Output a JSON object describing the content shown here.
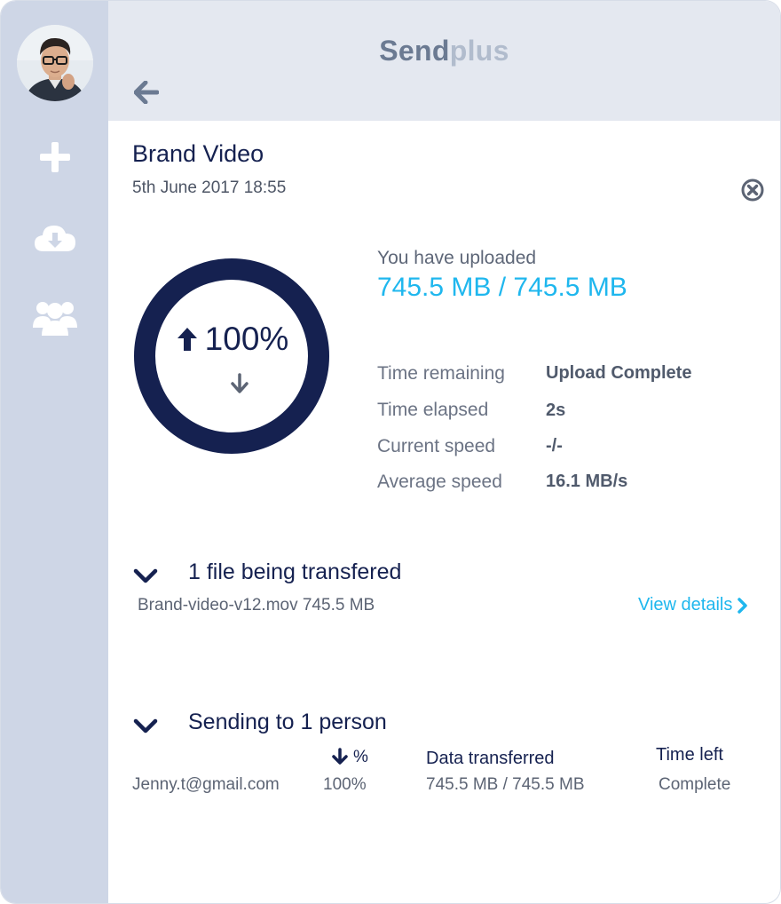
{
  "app": {
    "brand_part1": "Send",
    "brand_part2": "plus",
    "brand_color_primary": "#6b7a92",
    "brand_color_secondary": "#b1bccd",
    "accent_color": "#1fb7ee",
    "navy_color": "#152150"
  },
  "sidebar": {
    "items": [
      {
        "name": "avatar",
        "icon": "user-photo"
      },
      {
        "name": "new-transfer",
        "icon": "plus-icon"
      },
      {
        "name": "downloads",
        "icon": "cloud-download-icon"
      },
      {
        "name": "contacts",
        "icon": "users-icon"
      }
    ]
  },
  "transfer": {
    "title": "Brand Video",
    "date": "5th June 2017 18:55",
    "progress_text": "100%",
    "progress_fraction": 1.0,
    "uploaded_label": "You have uploaded",
    "uploaded_value": "745.5 MB / 745.5 MB",
    "stats": [
      {
        "label": "Time remaining",
        "value": "Upload Complete"
      },
      {
        "label": "Time elapsed",
        "value": "2s"
      },
      {
        "label": "Current speed",
        "value": "-/-"
      },
      {
        "label": "Average speed",
        "value": "16.1 MB/s"
      }
    ]
  },
  "files_section": {
    "title": "1 file being transfered",
    "file_line": "Brand-video-v12.mov 745.5 MB",
    "view_details": "View details"
  },
  "recipients_section": {
    "title": "Sending to 1 person",
    "headers": {
      "percent": "%",
      "data": "Data transferred",
      "time": "Time left"
    },
    "rows": [
      {
        "email": "Jenny.t@gmail.com",
        "percent": "100%",
        "data": "745.5 MB / 745.5 MB",
        "time": "Complete"
      }
    ]
  }
}
